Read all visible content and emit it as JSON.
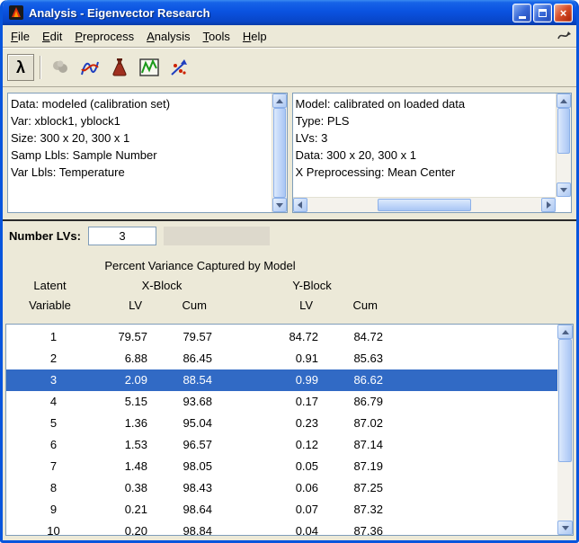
{
  "colors": {
    "titlebar_blue": "#0A52E0",
    "window_border": "#0855DD",
    "chrome_gray": "#ECE9D8",
    "selection_blue": "#316AC5",
    "panel_border": "#7F9DB9"
  },
  "window": {
    "title": "Analysis - Eigenvector Research"
  },
  "titlebar_buttons": {
    "minimize": "minimize",
    "maximize": "maximize",
    "close": "close"
  },
  "menu": {
    "items": [
      "File",
      "Edit",
      "Preprocess",
      "Analysis",
      "Tools",
      "Help"
    ]
  },
  "toolbar": {
    "lambda_glyph": "λ",
    "icons": [
      "lambda-icon",
      "refine-disabled-icon",
      "scores-plot-icon",
      "sample-flask-icon",
      "loadings-plot-icon",
      "biplot-icon"
    ]
  },
  "data_panel": {
    "lines": [
      "Data: modeled (calibration set)",
      "Var: xblock1, yblock1",
      "Size: 300 x 20, 300 x 1",
      "Samp Lbls: Sample Number",
      "Var Lbls: Temperature"
    ]
  },
  "model_panel": {
    "lines": [
      "Model: calibrated on loaded data",
      "Type: PLS",
      "LVs: 3",
      "Data: 300 x 20, 300 x 1",
      "X Preprocessing: Mean Center"
    ]
  },
  "lv_control": {
    "label": "Number LVs:",
    "value": "3"
  },
  "variance_table": {
    "title": "Percent Variance Captured by Model",
    "row_header": {
      "line1": "Latent",
      "line2": "Variable"
    },
    "groups": {
      "x": "X-Block",
      "y": "Y-Block"
    },
    "sub_headers": [
      "LV",
      "Cum",
      "LV",
      "Cum"
    ],
    "selected_row_index": 2,
    "rows": [
      [
        "1",
        "79.57",
        "79.57",
        "84.72",
        "84.72"
      ],
      [
        "2",
        "6.88",
        "86.45",
        "0.91",
        "85.63"
      ],
      [
        "3",
        "2.09",
        "88.54",
        "0.99",
        "86.62"
      ],
      [
        "4",
        "5.15",
        "93.68",
        "0.17",
        "86.79"
      ],
      [
        "5",
        "1.36",
        "95.04",
        "0.23",
        "87.02"
      ],
      [
        "6",
        "1.53",
        "96.57",
        "0.12",
        "87.14"
      ],
      [
        "7",
        "1.48",
        "98.05",
        "0.05",
        "87.19"
      ],
      [
        "8",
        "0.38",
        "98.43",
        "0.06",
        "87.25"
      ],
      [
        "9",
        "0.21",
        "98.64",
        "0.07",
        "87.32"
      ],
      [
        "10",
        "0.20",
        "98.84",
        "0.04",
        "87.36"
      ]
    ]
  }
}
